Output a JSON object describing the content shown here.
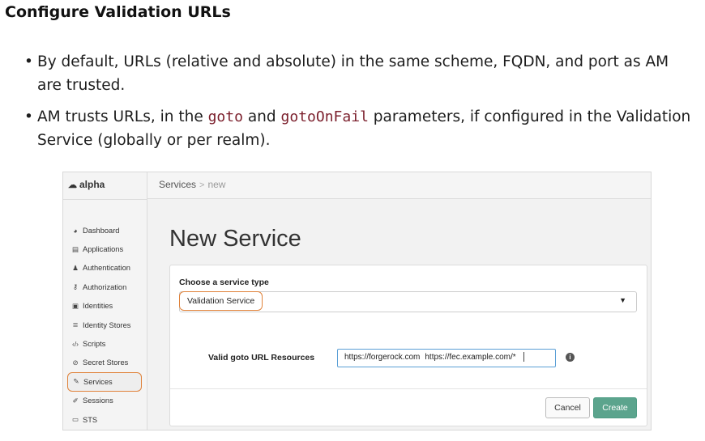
{
  "slide": {
    "title": "Configure Validation URLs",
    "bullets": [
      {
        "text": "By default, URLs (relative and absolute) in the same scheme, FQDN, and port as AM are trusted."
      },
      {
        "before": "AM trusts URLs, in the ",
        "code1": "goto",
        "middle": " and ",
        "code2": "gotoOnFail",
        "after": " parameters, if configured in the Validation Service (globally or per realm)."
      }
    ]
  },
  "app": {
    "realm": "alpha",
    "realm_icon": "cloud-icon",
    "nav": [
      {
        "label": "Dashboard",
        "icon": "dashboard-icon"
      },
      {
        "label": "Applications",
        "icon": "applications-icon"
      },
      {
        "label": "Authentication",
        "icon": "user-icon"
      },
      {
        "label": "Authorization",
        "icon": "key-icon"
      },
      {
        "label": "Identities",
        "icon": "id-card-icon"
      },
      {
        "label": "Identity Stores",
        "icon": "database-icon"
      },
      {
        "label": "Scripts",
        "icon": "code-icon"
      },
      {
        "label": "Secret Stores",
        "icon": "secret-icon"
      },
      {
        "label": "Services",
        "icon": "plug-icon"
      },
      {
        "label": "Sessions",
        "icon": "sessions-icon"
      },
      {
        "label": "STS",
        "icon": "card-icon"
      }
    ],
    "active_nav": "Services",
    "breadcrumb": {
      "root": "Services",
      "sep": ">",
      "current": "new"
    },
    "page_title": "New Service",
    "form": {
      "type_label": "Choose a service type",
      "type_value": "Validation Service",
      "url_label": "Valid goto URL Resources",
      "url_values": [
        "https://forgerock.com",
        "https://fec.example.com/*"
      ]
    },
    "buttons": {
      "cancel": "Cancel",
      "create": "Create"
    },
    "colors": {
      "highlight": "#e0823a",
      "primary": "#5ba48d",
      "focus": "#5a9fd6"
    }
  }
}
